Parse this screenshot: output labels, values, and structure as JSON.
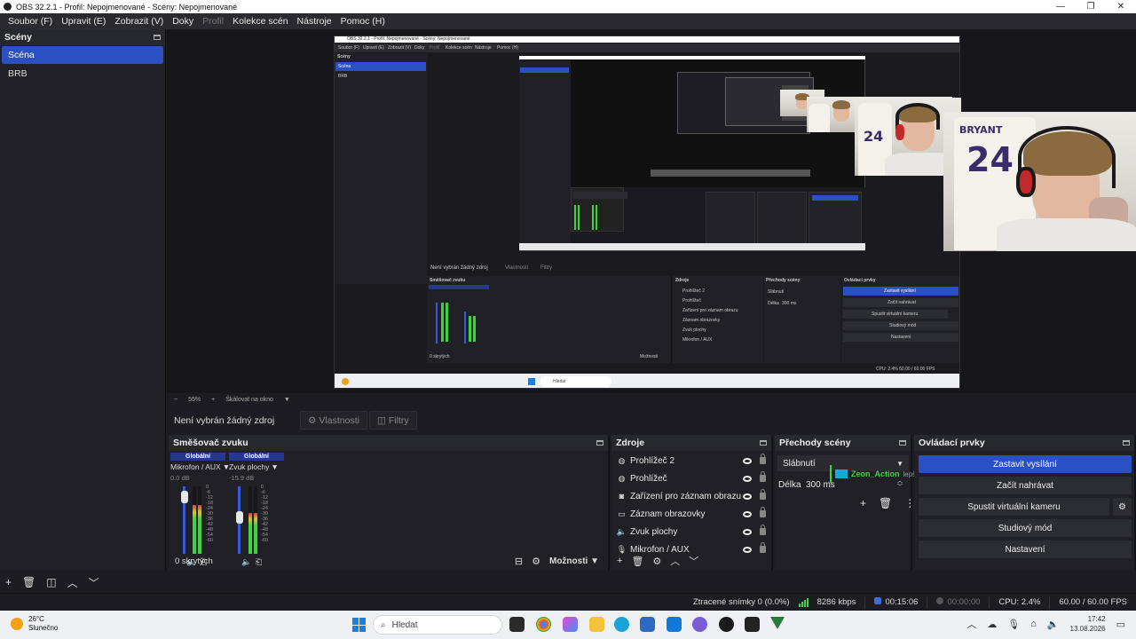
{
  "window": {
    "title": "OBS 32.2.1 - Profil: Nepojmenované - Scény: Nepojmenované"
  },
  "menu": [
    "Soubor (F)",
    "Upravit (E)",
    "Zobrazit (V)",
    "Doky",
    "Profil",
    "Kolekce scén",
    "Nástroje",
    "Pomoc (H)"
  ],
  "scenes": {
    "title": "Scény",
    "items": [
      "Scéna",
      "BRB"
    ],
    "active_index": 0
  },
  "preview": {
    "zoom_minus": "−",
    "zoom_level": "55%",
    "zoom_plus": "+",
    "scale_mode": "Škálovat na okno"
  },
  "properties_bar": {
    "no_source": "Není vybrán žádný zdroj",
    "properties": "Vlastnosti",
    "filters": "Filtry"
  },
  "mixer": {
    "title": "Směšovač zvuku",
    "channels": [
      {
        "global": "Globální",
        "name": "Mikrofon / AUX",
        "db": "0.0 dB",
        "level": 0.72,
        "fader": 0.92
      },
      {
        "global": "Globální",
        "name": "Zvuk plochy",
        "db": "-15.9 dB",
        "level": 0.6,
        "fader": 0.55
      }
    ],
    "scale": [
      "0",
      "-6",
      "-12",
      "-18",
      "-24",
      "-30",
      "-36",
      "-42",
      "-48",
      "-54",
      "-60"
    ],
    "hidden": "0 skrytých",
    "options": "Možnosti"
  },
  "sources": {
    "title": "Zdroje",
    "items": [
      {
        "name": "Prohlížeč 2",
        "icon": "globe-icon"
      },
      {
        "name": "Prohlížeč",
        "icon": "globe-icon"
      },
      {
        "name": "Zařízení pro záznam obrazu",
        "icon": "camera-icon"
      },
      {
        "name": "Záznam obrazovky",
        "icon": "monitor-icon"
      },
      {
        "name": "Zvuk plochy",
        "icon": "speaker-icon"
      },
      {
        "name": "Mikrofon / AUX",
        "icon": "microphone-icon"
      }
    ]
  },
  "transitions": {
    "title": "Přechody scény",
    "selected": "Slábnutí",
    "duration_label": "Délka",
    "duration_value": "300 ms",
    "overlay_text": "Zeon_Action",
    "overlay_suffix": "lepší"
  },
  "controls": {
    "title": "Ovládací prvky",
    "buttons": [
      "Zastavit vysílání",
      "Začít nahrávat",
      "Spustit virtuální kameru",
      "Studiový mód",
      "Nastavení"
    ]
  },
  "status": {
    "dropped": "Ztracené snímky 0 (0.0%)",
    "bitrate": "8286 kbps",
    "stream_time": "00:15:06",
    "rec_time": "00:00:00",
    "cpu": "CPU: 2.4%",
    "fps": "60.00 / 60.00 FPS"
  },
  "taskbar": {
    "temp": "26°C",
    "weather": "Slunečno",
    "search": "Hledat",
    "time": "17:42",
    "date": "13.08.2026"
  },
  "program_nested": {
    "menu": [
      "Soubor (F)",
      "Upravit (E)",
      "Zobrazit (V)",
      "Doky",
      "Profil",
      "Kolekce scén",
      "Nástroje",
      "Pomoc (H)"
    ],
    "title": "OBS 32.2.1 - Profil: Nepojmenované - Scény: Nepojmenované",
    "scenes_title": "Scény",
    "scene_items": [
      "Scéna",
      "BRB"
    ],
    "props_label": "Není vybrán žádný zdroj",
    "props_btn": "Vlastnosti",
    "filters_btn": "Filtry",
    "mixer_title": "Směšovač zvuku",
    "sources_title": "Zdroje",
    "transitions_title": "Přechody scény",
    "controls_title": "Ovládací prvky",
    "source_items": [
      "Prohlížeč 2",
      "Prohlížeč",
      "Zařízení pro záznam obrazu",
      "Záznam obrazovky",
      "Zvuk plochy",
      "Mikrofon / AUX"
    ],
    "control_items": [
      "Zastavit vysílání",
      "Začít nahrávat",
      "Spustit virtuální kameru",
      "Studiový mód",
      "Nastavení"
    ],
    "fade": "Slábnutí",
    "duration_label": "Délka",
    "duration": "300 ms",
    "hidden": "0 skrytých",
    "options": "Možnosti",
    "status_right": "CPU: 2.4%   60.00 / 60.00 FPS",
    "taskbar_search": "Hledat",
    "jersey_name": "BRYANT",
    "jersey_number": "24"
  }
}
